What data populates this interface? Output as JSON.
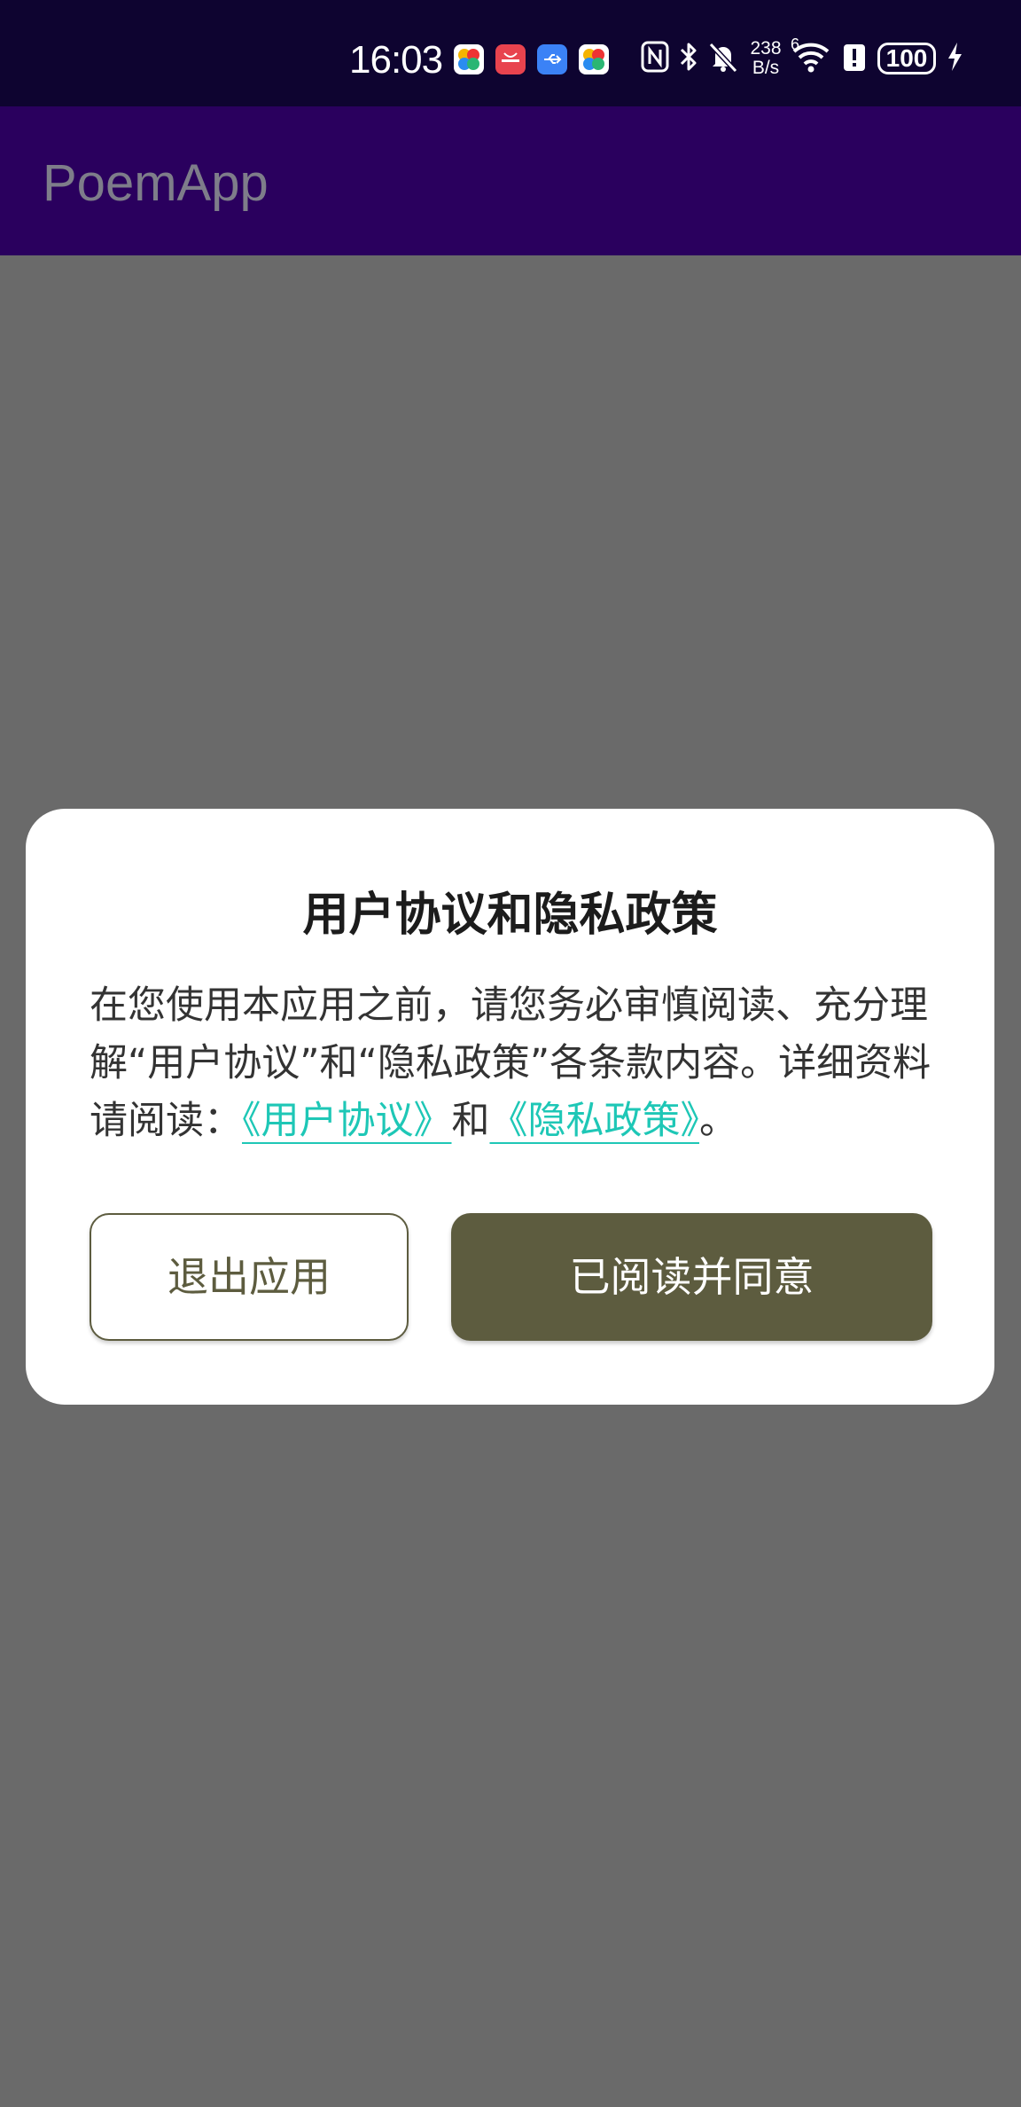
{
  "status_bar": {
    "time": "16:03",
    "net_speed_value": "238",
    "net_speed_unit": "B/s",
    "signal_label": "6",
    "battery": "100",
    "app_icons": [
      "app-store-icon",
      "huawei-store-icon",
      "usb-icon",
      "app-store-icon"
    ],
    "status_icons": [
      "nfc-icon",
      "bluetooth-icon",
      "mute-icon",
      "wifi-icon",
      "alert-icon",
      "charging-icon"
    ]
  },
  "app_bar": {
    "title": "PoemApp"
  },
  "dialog": {
    "title": "用户协议和隐私政策",
    "body_prefix": "在您使用本应用之前，请您务必审慎阅读、充分理解“用户协议”和“隐私政策”各条款内容。详细资料请阅读：",
    "user_agreement_link": "《用户协议》",
    "connector": "和",
    "privacy_policy_link": "《隐私政策》",
    "body_suffix": "。",
    "exit_button": "退出应用",
    "agree_button": "已阅读并同意"
  },
  "colors": {
    "status_bar_bg": "#0e0430",
    "app_bar_bg": "#2a005e",
    "scrim": "#6a6a6a",
    "link": "#1ec7b6",
    "primary_button": "#5d5c3f"
  }
}
